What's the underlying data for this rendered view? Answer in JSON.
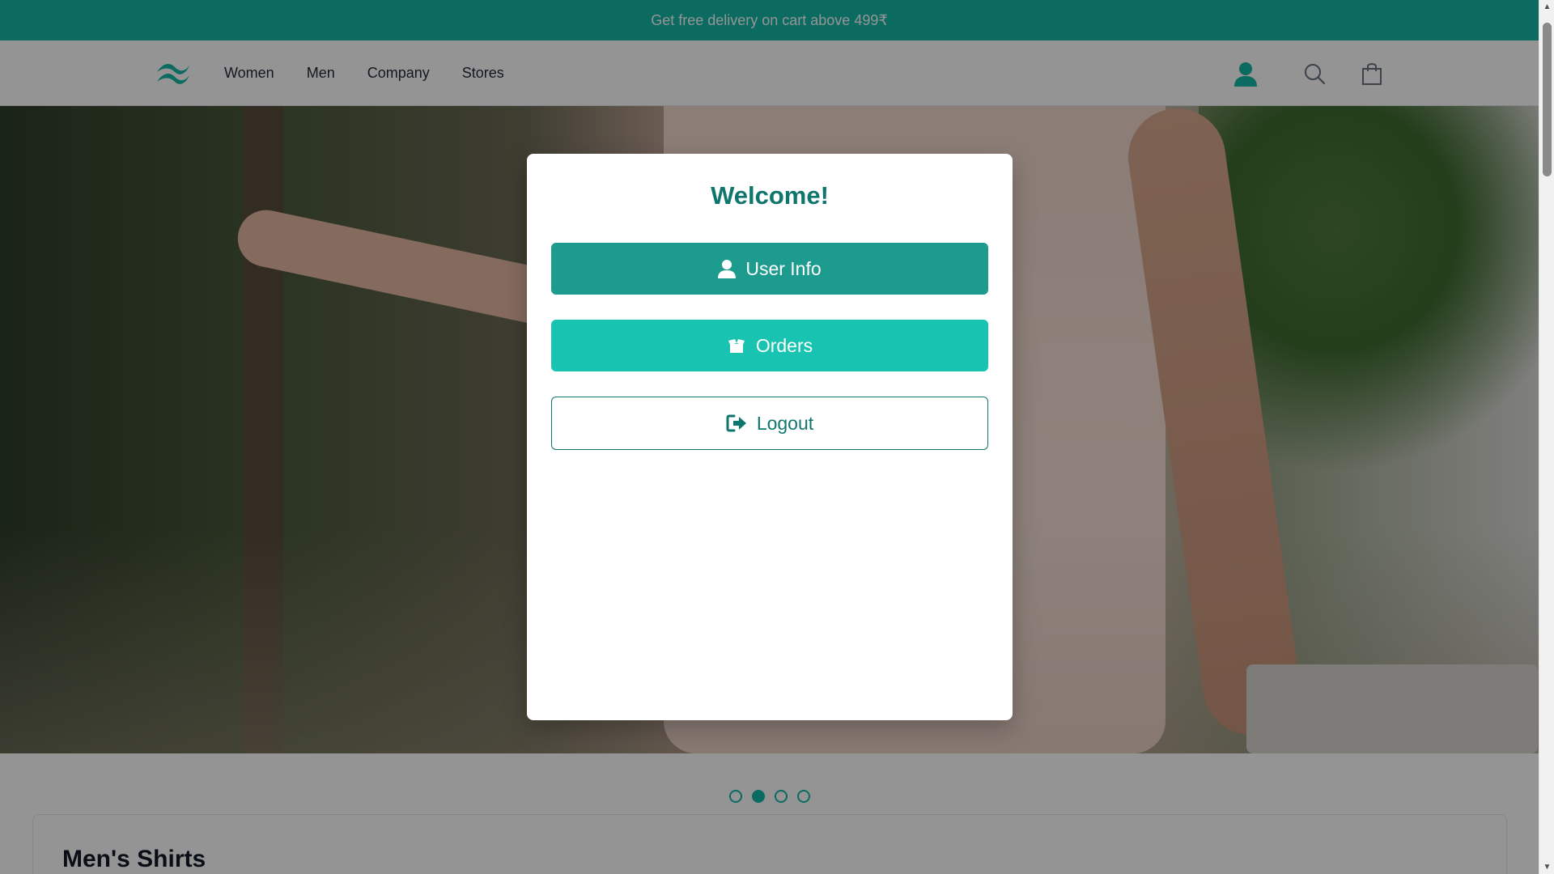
{
  "announcement": {
    "text": "Get free delivery on cart above 499₹"
  },
  "header": {
    "logo_icon": "wave-logo-icon",
    "nav": [
      {
        "label": "Women"
      },
      {
        "label": "Men"
      },
      {
        "label": "Company"
      },
      {
        "label": "Stores"
      }
    ],
    "icons": [
      "user-icon",
      "search-icon",
      "shopping-bag-icon"
    ]
  },
  "hero": {
    "image": "woman-in-pink-floral-dress-photo"
  },
  "carousel": {
    "dots": 4,
    "active_index": 1
  },
  "section": {
    "title": "Men's Shirts"
  },
  "modal": {
    "title": "Welcome!",
    "buttons": {
      "user_info": "User Info",
      "orders": "Orders",
      "logout": "Logout"
    }
  },
  "colors": {
    "brand": "#14b8a6",
    "brand_dark": "#0f766e",
    "user_info_button": "#1d9b8e",
    "orders_button": "#18c3b1"
  }
}
